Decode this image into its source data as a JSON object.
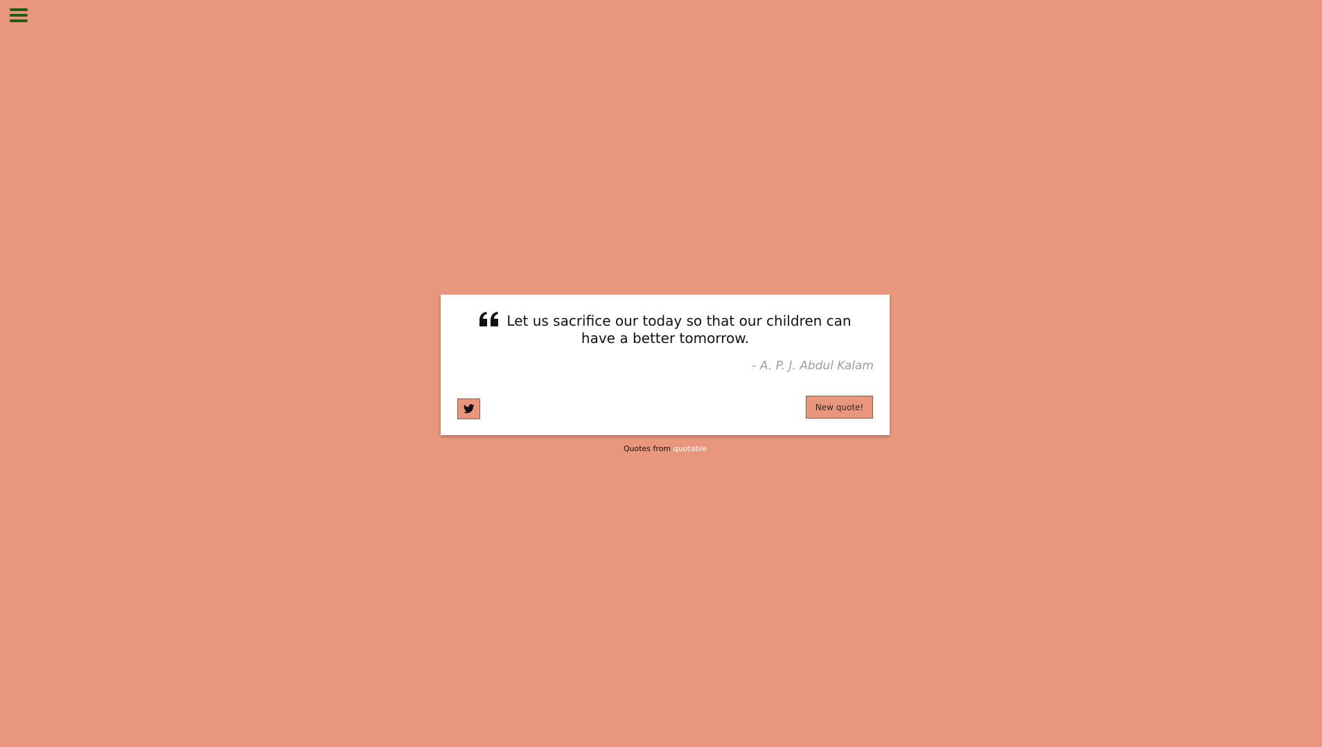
{
  "icons": {
    "menu": "hamburger-menu-icon",
    "quote": "quote-left-icon",
    "twitter": "twitter-bird-icon"
  },
  "colors": {
    "background": "#e8977c",
    "menu_icon": "#1f5f12",
    "card": "#ffffff",
    "author_text": "#9e9e9e",
    "link": "#ffffff"
  },
  "quote": {
    "text": "Let us sacrifice our today so that our children can have a better tomorrow.",
    "author": "- A. P. J. Abdul Kalam"
  },
  "actions": {
    "new_quote_label": "New quote!"
  },
  "footer": {
    "prefix": "Quotes from",
    "link_label": "quotable"
  }
}
